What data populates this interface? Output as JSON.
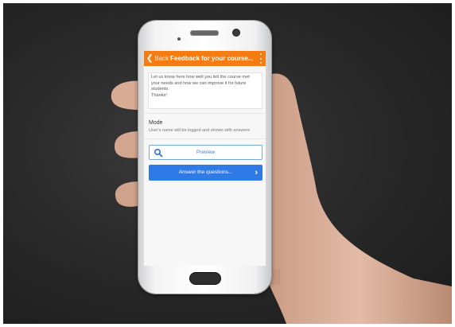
{
  "app_bar": {
    "back_label": "Back",
    "title": "Feedback for your course..."
  },
  "intro": {
    "text": "Let us know here how well you felt the course met\nyour needs and how we can improve it for future\nstudents.\nThanks!"
  },
  "mode": {
    "label": "Mode",
    "description": "User's name will be logged and shown with answers"
  },
  "actions": {
    "preview_label": "Preview",
    "answer_label": "Answer the questions..."
  },
  "colors": {
    "app_bar": "#f47c12",
    "primary_button": "#2f7ae6",
    "outline_button": "#79a6e6"
  },
  "icons": {
    "back": "chevron-left-icon",
    "menu": "overflow-menu-icon",
    "preview": "search-icon",
    "answer": "chevron-right-icon"
  }
}
